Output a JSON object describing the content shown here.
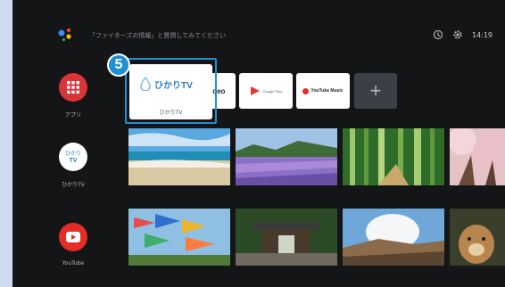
{
  "top_bar": {
    "search_hint": "「ファイターズの情報」と質問してみてください",
    "time": "14:19"
  },
  "sidebar": {
    "items": [
      {
        "label": "アプリ",
        "icon": "apps-grid-icon",
        "color": "#d9343a"
      },
      {
        "label": "ひかりTV",
        "icon": "hikari-tv-icon",
        "color": "#ffffff"
      },
      {
        "label": "YouTube",
        "icon": "youtube-icon",
        "color": "#e52d27"
      }
    ]
  },
  "app_row": {
    "focused": {
      "logo_text": "ひかりTV",
      "caption": "ひかりTV"
    },
    "apps": [
      {
        "name": "videopass",
        "logo_text": "video"
      },
      {
        "name": "google-play-movies",
        "logo_text": "Google Play"
      },
      {
        "name": "youtube-music",
        "logo_text": "YouTube Music"
      },
      {
        "name": "add-app",
        "logo_text": "+"
      }
    ]
  },
  "callout": {
    "number": "5",
    "color": "#1f8fd6"
  },
  "content_rows": [
    [
      "beach",
      "lavender field",
      "bamboo forest",
      "cherry blossoms"
    ],
    [
      "koinobori streamers",
      "temple gate",
      "volcanic steam",
      "puppy"
    ]
  ]
}
